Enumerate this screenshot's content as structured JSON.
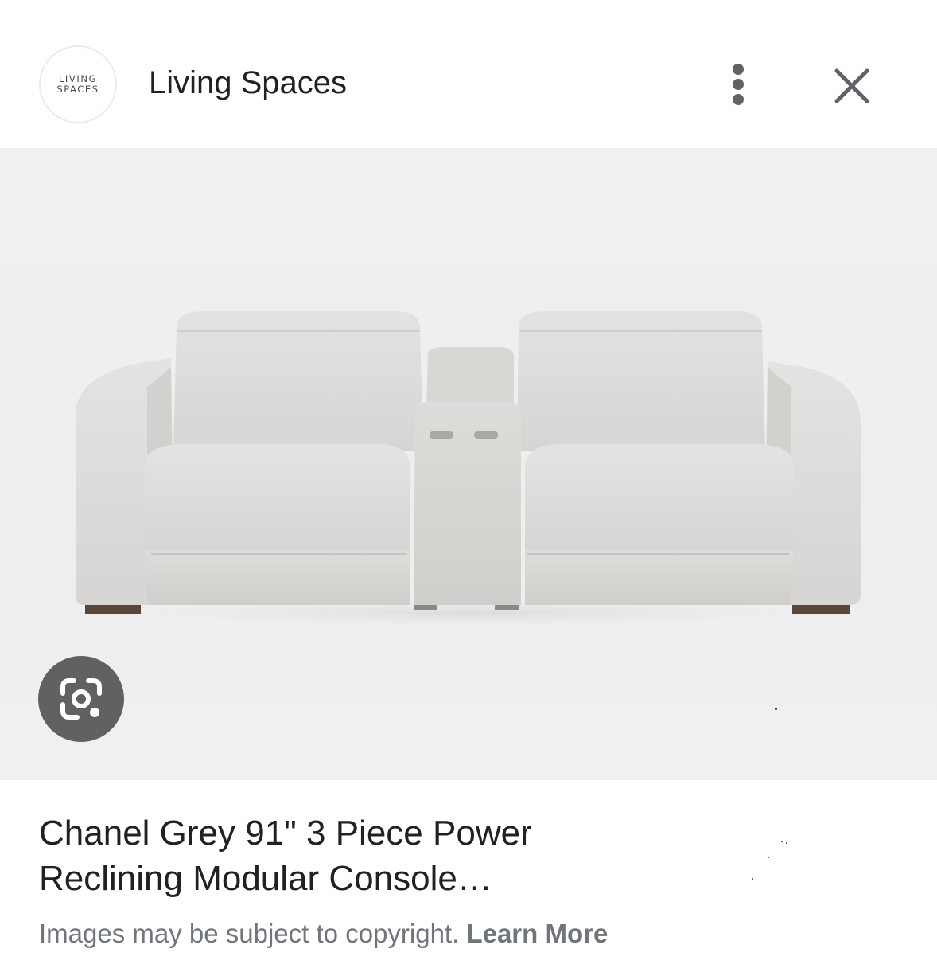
{
  "header": {
    "logo_line1": "LIVING",
    "logo_line2": "SPACES",
    "site_name": "Living Spaces",
    "more_icon": "more-vert-icon",
    "close_icon": "close-icon"
  },
  "image": {
    "lens_icon": "google-lens-icon",
    "colors": {
      "sofa": "#dcdbd9",
      "background": "#eceef0",
      "lens_button": "#5f6163"
    }
  },
  "result": {
    "title_line1": "Chanel Grey 91\" 3 Piece Power",
    "title_line2": "Reclining Modular Console…",
    "copyright_text": "Images may be subject to copyright.",
    "learn_more": "Learn More"
  }
}
